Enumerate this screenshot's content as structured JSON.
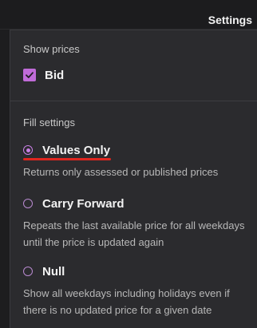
{
  "header": {
    "title": "Settings"
  },
  "show_prices": {
    "title": "Show prices",
    "bid": {
      "label": "Bid",
      "checked": true
    }
  },
  "fill_settings": {
    "title": "Fill settings",
    "selected": "values_only",
    "options": [
      {
        "id": "values_only",
        "label": "Values Only",
        "description": "Returns only assessed or published prices",
        "checked": true
      },
      {
        "id": "carry_forward",
        "label": "Carry Forward",
        "description": "Repeats the last available price for all weekdays until the price is updated again",
        "checked": false
      },
      {
        "id": "null",
        "label": "Null",
        "description": "Show all weekdays including holidays even if there is no updated price for a given date",
        "checked": false
      }
    ]
  },
  "colors": {
    "accent": "#c06bd8",
    "annotation_underline": "#e0261f",
    "panel_background": "#2b2b2e"
  }
}
